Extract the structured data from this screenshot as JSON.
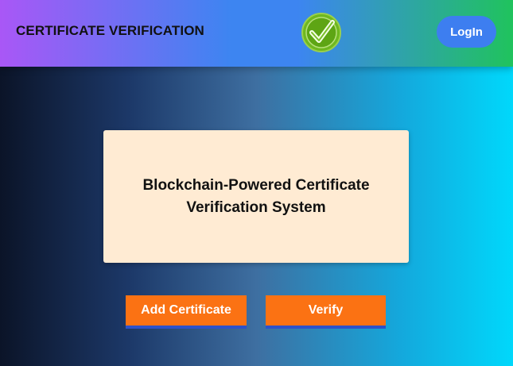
{
  "header": {
    "title": "CERTIFICATE VERIFICATION",
    "logo_icon": "verified-check-icon",
    "login_label": "LogIn"
  },
  "hero": {
    "heading": "Blockchain-Powered Certificate Verification System"
  },
  "actions": {
    "add_label": "Add Certificate",
    "verify_label": "Verify"
  },
  "colors": {
    "header_gradient": [
      "#a957f6",
      "#3d85f1",
      "#20c35d"
    ],
    "background_gradient": [
      "#0b1428",
      "#3e6fa1",
      "#00d8fb"
    ],
    "card_background": "#ffebd3",
    "action_button": "#fb7213",
    "action_button_accent": "#2d52c9",
    "login_button": "#3d7ef0"
  }
}
